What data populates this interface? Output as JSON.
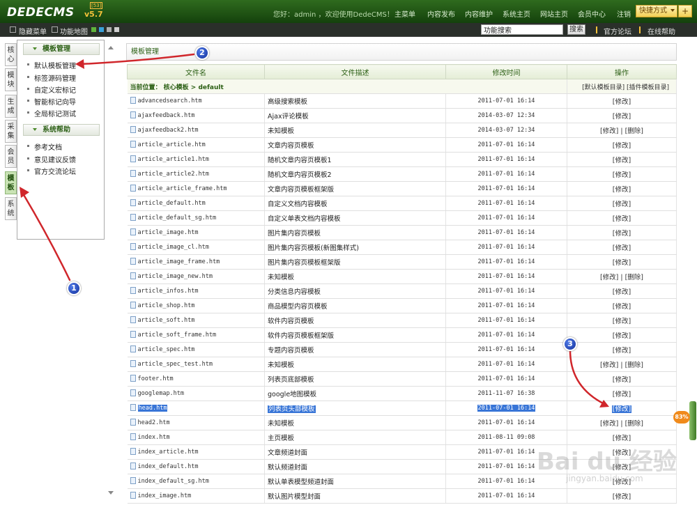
{
  "topbar": {
    "logo": "DEDECMS",
    "version": "v5.7",
    "badge": "[53]",
    "welcome": "您好：admin ，欢迎使用DedeCMS！",
    "nav": [
      "主菜单",
      "内容发布",
      "内容维护",
      "系统主页",
      "网站主页",
      "会员中心",
      "注销"
    ],
    "quick": "快捷方式",
    "quick_plus": "+"
  },
  "subbar": {
    "hide_menu": "隐藏菜单",
    "func_map": "功能地图",
    "swatches": [
      "#5fb33b",
      "#3aa1d8",
      "#b0b0b0",
      "#cfcfcf"
    ],
    "search_placeholder": "功能搜索",
    "search_btn": "搜索",
    "links": [
      "官方论坛",
      "在线帮助"
    ]
  },
  "sidetabs": [
    {
      "label": "核心",
      "active": false
    },
    {
      "label": "模块",
      "active": false
    },
    {
      "label": "生成",
      "active": false
    },
    {
      "label": "采集",
      "active": false
    },
    {
      "label": "会员",
      "active": false
    },
    {
      "label": "模板",
      "active": true
    },
    {
      "label": "系统",
      "active": false
    }
  ],
  "menu": {
    "group1": {
      "title": "模板管理",
      "items": [
        "默认模板管理",
        "标签源码管理",
        "自定义宏标记",
        "智能标记向导",
        "全局标记测试"
      ]
    },
    "group2": {
      "title": "系统帮助",
      "items": [
        "参考文档",
        "意见建议反馈",
        "官方交流论坛"
      ]
    }
  },
  "main": {
    "title": "模板管理",
    "columns": [
      "文件名",
      "文件描述",
      "修改时间",
      "操作"
    ],
    "location": {
      "prefix": "当前位置：",
      "path": "核心模板 > default",
      "link1": "[默认模板目录]",
      "link2": "[插件模板目录]"
    },
    "rows": [
      {
        "file": "advancedsearch.htm",
        "desc": "高级搜索模板",
        "time": "2011-07-01 16:14",
        "op": "[修改]"
      },
      {
        "file": "ajaxfeedback.htm",
        "desc": "Ajax评论模板",
        "time": "2014-03-07 12:34",
        "op": "[修改]"
      },
      {
        "file": "ajaxfeedback2.htm",
        "desc": "未知模板",
        "time": "2014-03-07 12:34",
        "op": "[修改] | [删除]"
      },
      {
        "file": "article_article.htm",
        "desc": "文章内容页模板",
        "time": "2011-07-01 16:14",
        "op": "[修改]"
      },
      {
        "file": "article_article1.htm",
        "desc": "随机文章内容页模板1",
        "time": "2011-07-01 16:14",
        "op": "[修改]"
      },
      {
        "file": "article_article2.htm",
        "desc": "随机文章内容页模板2",
        "time": "2011-07-01 16:14",
        "op": "[修改]"
      },
      {
        "file": "article_article_frame.htm",
        "desc": "文章内容页模板框架版",
        "time": "2011-07-01 16:14",
        "op": "[修改]"
      },
      {
        "file": "article_default.htm",
        "desc": "自定义文档内容模板",
        "time": "2011-07-01 16:14",
        "op": "[修改]"
      },
      {
        "file": "article_default_sg.htm",
        "desc": "自定义单表文档内容模板",
        "time": "2011-07-01 16:14",
        "op": "[修改]"
      },
      {
        "file": "article_image.htm",
        "desc": "图片集内容页模板",
        "time": "2011-07-01 16:14",
        "op": "[修改]"
      },
      {
        "file": "article_image_cl.htm",
        "desc": "图片集内容页模板(新图集样式)",
        "time": "2011-07-01 16:14",
        "op": "[修改]"
      },
      {
        "file": "article_image_frame.htm",
        "desc": "图片集内容页模板框架版",
        "time": "2011-07-01 16:14",
        "op": "[修改]"
      },
      {
        "file": "article_image_new.htm",
        "desc": "未知模板",
        "time": "2011-07-01 16:14",
        "op": "[修改] | [删除]"
      },
      {
        "file": "article_infos.htm",
        "desc": "分类信息内容模板",
        "time": "2011-07-01 16:14",
        "op": "[修改]"
      },
      {
        "file": "article_shop.htm",
        "desc": "商品模型内容页模板",
        "time": "2011-07-01 16:14",
        "op": "[修改]"
      },
      {
        "file": "article_soft.htm",
        "desc": "软件内容页模板",
        "time": "2011-07-01 16:14",
        "op": "[修改]"
      },
      {
        "file": "article_soft_frame.htm",
        "desc": "软件内容页模板框架版",
        "time": "2011-07-01 16:14",
        "op": "[修改]"
      },
      {
        "file": "article_spec.htm",
        "desc": "专题内容页模板",
        "time": "2011-07-01 16:14",
        "op": "[修改]"
      },
      {
        "file": "article_spec_test.htm",
        "desc": "未知模板",
        "time": "2011-07-01 16:14",
        "op": "[修改] | [删除]"
      },
      {
        "file": "footer.htm",
        "desc": "列表页底部模板",
        "time": "2011-07-01 16:14",
        "op": "[修改]"
      },
      {
        "file": "googlemap.htm",
        "desc": "google地图模板",
        "time": "2011-11-07 16:38",
        "op": "[修改]"
      },
      {
        "file": "head.htm",
        "desc": "列表页头部模板",
        "time": "2011-07-01 16:14",
        "op": "[修改]",
        "highlight": true
      },
      {
        "file": "head2.htm",
        "desc": "未知模板",
        "time": "2011-07-01 16:14",
        "op": "[修改] | [删除]"
      },
      {
        "file": "index.htm",
        "desc": "主页模板",
        "time": "2011-08-11 09:08",
        "op": "[修改]"
      },
      {
        "file": "index_article.htm",
        "desc": "文章频道封面",
        "time": "2011-07-01 16:14",
        "op": "[修改]"
      },
      {
        "file": "index_default.htm",
        "desc": "默认频道封面",
        "time": "2011-07-01 16:14",
        "op": "[修改]"
      },
      {
        "file": "index_default_sg.htm",
        "desc": "默认单表模型频道封面",
        "time": "2011-07-01 16:14",
        "op": "[修改]"
      },
      {
        "file": "index_image.htm",
        "desc": "默认图片模型封面",
        "time": "2011-07-01 16:14",
        "op": "[修改]"
      }
    ]
  },
  "annotations": [
    "1",
    "2",
    "3"
  ],
  "badge_percent": "83%",
  "watermark": "Bai du 经验",
  "watermark_url": "jingyan.baidu.com",
  "colors": {
    "header_green": "#2f6b1e",
    "highlight": "#3875d7",
    "arrow": "#d0262b",
    "annotation": "#1f3fb8"
  }
}
